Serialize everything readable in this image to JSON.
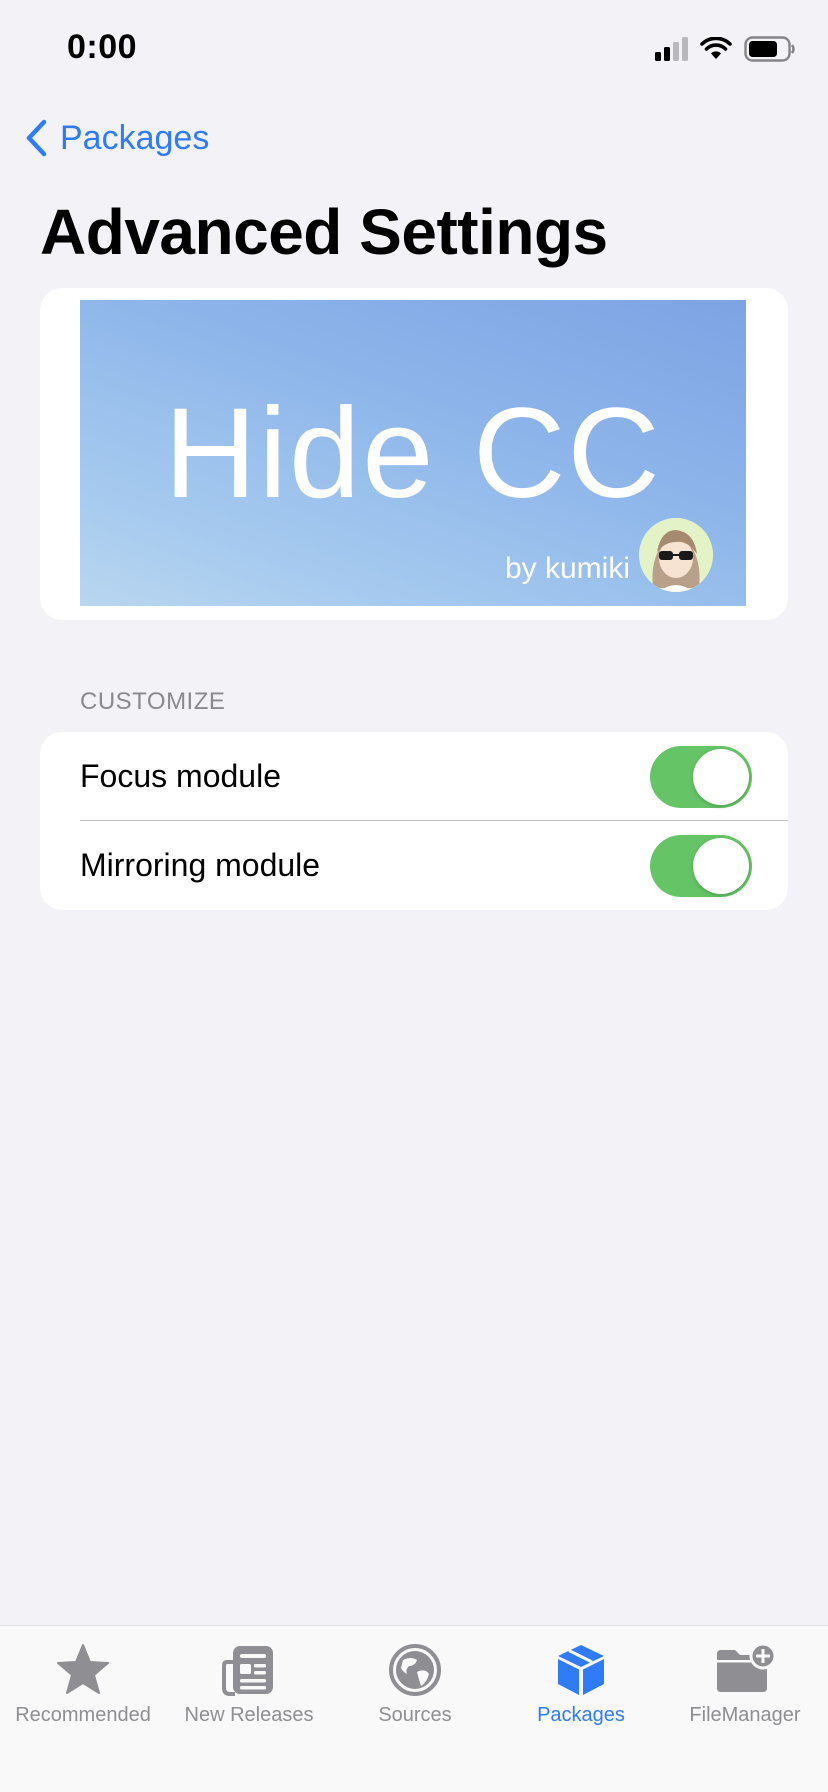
{
  "status_bar": {
    "time": "0:00"
  },
  "nav": {
    "back_label": "Packages",
    "title": "Advanced Settings"
  },
  "banner": {
    "title": "Hide CC",
    "author": "by kumiki"
  },
  "customize": {
    "header": "CUSTOMIZE",
    "rows": [
      {
        "label": "Focus module",
        "enabled": true
      },
      {
        "label": "Mirroring module",
        "enabled": true
      }
    ]
  },
  "tab_bar": {
    "tabs": [
      {
        "label": "Recommended",
        "icon": "star-icon",
        "active": false
      },
      {
        "label": "New Releases",
        "icon": "newspaper-icon",
        "active": false
      },
      {
        "label": "Sources",
        "icon": "globe-icon",
        "active": false
      },
      {
        "label": "Packages",
        "icon": "package-icon",
        "active": true
      },
      {
        "label": "FileManager",
        "icon": "folder-add-icon",
        "active": false
      }
    ]
  },
  "colors": {
    "accent": "#2f7cf6",
    "toggle_on": "#65c466",
    "background": "#f2f2f7",
    "inactive_tab": "#8e8e93"
  }
}
